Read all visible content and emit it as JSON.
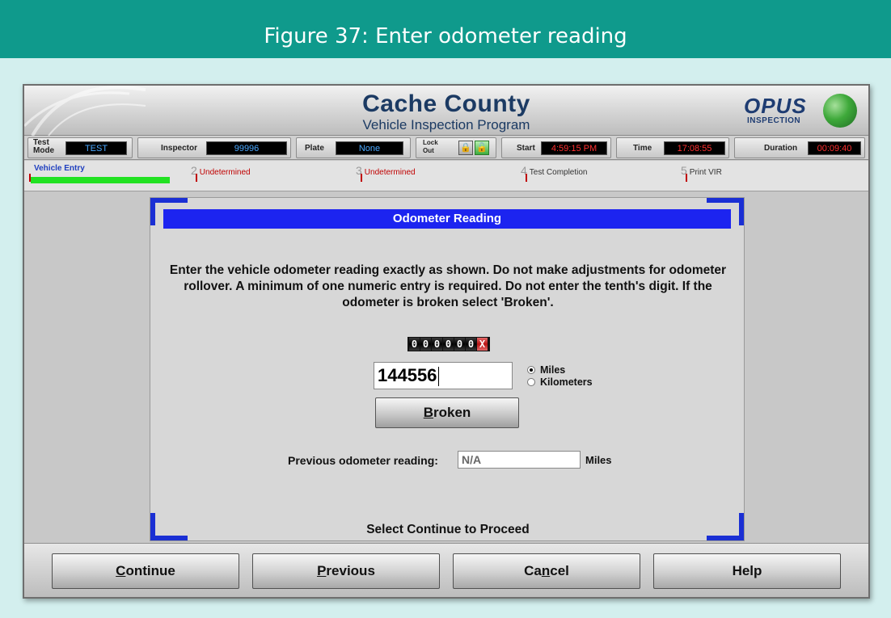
{
  "figure": {
    "caption": "Figure 37: Enter odometer reading"
  },
  "app": {
    "title": "Cache County",
    "subtitle": "Vehicle Inspection Program",
    "logo_text": "OPUS",
    "logo_subtext": "INSPECTION"
  },
  "status": {
    "test_mode_label": "Test Mode",
    "test_mode_value": "TEST",
    "inspector_label": "Inspector",
    "inspector_value": "99996",
    "plate_label": "Plate",
    "plate_value": "None",
    "lock_label": "Lock Out",
    "start_label": "Start",
    "start_value": "4:59:15 PM",
    "time_label": "Time",
    "time_value": "17:08:55",
    "duration_label": "Duration",
    "duration_value": "00:09:40"
  },
  "steps": [
    {
      "num": "1",
      "label": "Vehicle Entry"
    },
    {
      "num": "2",
      "label": "Undetermined"
    },
    {
      "num": "3",
      "label": "Undetermined"
    },
    {
      "num": "4",
      "label": "Test Completion"
    },
    {
      "num": "5",
      "label": "Print VIR"
    }
  ],
  "dialog": {
    "title": "Odometer Reading",
    "instructions": "Enter the vehicle odometer reading exactly as shown. Do not make adjustments for odometer rollover. A minimum of one numeric entry is required. Do not enter the tenth's digit. If the odometer is broken select 'Broken'.",
    "odometer_digits": [
      "0",
      "0",
      "0",
      "0",
      "0",
      "0"
    ],
    "odometer_tenth": "X",
    "odometer_value": "144556",
    "unit_miles": "Miles",
    "unit_km": "Kilometers",
    "unit_selected": "Miles",
    "broken_pre": "",
    "broken_ul": "B",
    "broken_post": "roken",
    "prev_label": "Previous odometer reading:",
    "prev_value": "N/A",
    "prev_unit": "Miles",
    "proceed_text": "Select Continue to Proceed"
  },
  "footer": {
    "continue_ul": "C",
    "continue_rest": "ontinue",
    "previous_ul": "P",
    "previous_rest": "revious",
    "cancel_pre": "Ca",
    "cancel_ul": "n",
    "cancel_post": "cel",
    "help": "Help"
  },
  "colors": {
    "header_teal": "#0f9a8c",
    "title_blue": "#1c24f0",
    "progress_green": "#22e222",
    "status_red": "#c00000"
  }
}
